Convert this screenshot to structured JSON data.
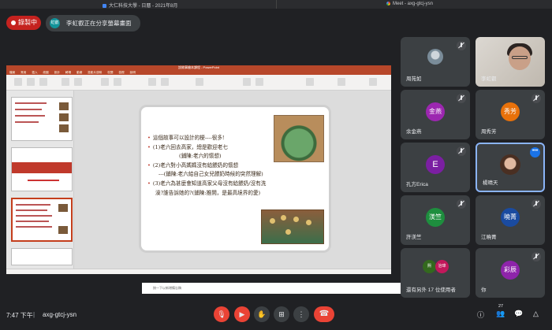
{
  "os_tabs": {
    "left_title": "大仁科技大學 - 日曆 - 2021年8月",
    "right_title": "Meet - axg-gtcj-ysn"
  },
  "recording": {
    "label": "錄製中"
  },
  "presenting": {
    "avatar_text": "虹叡",
    "label": "李虹叡正在分享螢幕畫面"
  },
  "powerpoint": {
    "title": "說故事繪本課程 - PowerPoint",
    "menu": "檔案 常用 插入 繪圖 設計 轉場 動畫 投影片放映 校閱 檢視 說明",
    "notes": "按一下以新增備忘稿",
    "slide_lines": [
      "這個故事可以設計的梗----很多!",
      "(1)老六回去高家，總是歡迎老七",
      "(鋪陳:老六的懷想)",
      "(2)老六對小高媽媽沒有給餵奶的懷想",
      "---(鋪陳:老六給自己女兒餵奶時候的突然理解)",
      "(3)老六為甚麼會知道高家父母沒有給餵奶/沒有洗",
      "澡?誰告訴她的?(鋪陳:推開，是最高境界的愛)"
    ]
  },
  "participants": [
    {
      "name": "周苑如",
      "initials": ""
    },
    {
      "name": "李虹叡",
      "initials": ""
    },
    {
      "name": "余金燕",
      "initials": "金燕",
      "color": "#9c27b0"
    },
    {
      "name": "周秀芳",
      "initials": "秀芳",
      "color": "#e8710a"
    },
    {
      "name": "孔方Erica",
      "initials": "E",
      "color": "#7b1fa2"
    },
    {
      "name": "楊晴天",
      "initials": ""
    },
    {
      "name": "許渼竺",
      "initials": "渼竺",
      "color": "#1e8e3e"
    },
    {
      "name": "江曉菁",
      "initials": "曉菁",
      "color": "#1a4ba0"
    },
    {
      "name": "還有另外 17 位使用者",
      "initials": ""
    },
    {
      "name": "你",
      "initials": "彩辰",
      "color": "#8e24aa"
    }
  ],
  "others_avatars": {
    "a": "熙",
    "b": "治瑋"
  },
  "bottom": {
    "time": "7:47 下午",
    "separator": "|",
    "meeting_code": "axg-gtcj-ysn",
    "participant_count": "27"
  },
  "colors": {
    "background": "#202124",
    "tile": "#3c4043",
    "record_red": "#c5221f",
    "hangup_red": "#ea4335",
    "ppt_orange": "#b7472a"
  }
}
